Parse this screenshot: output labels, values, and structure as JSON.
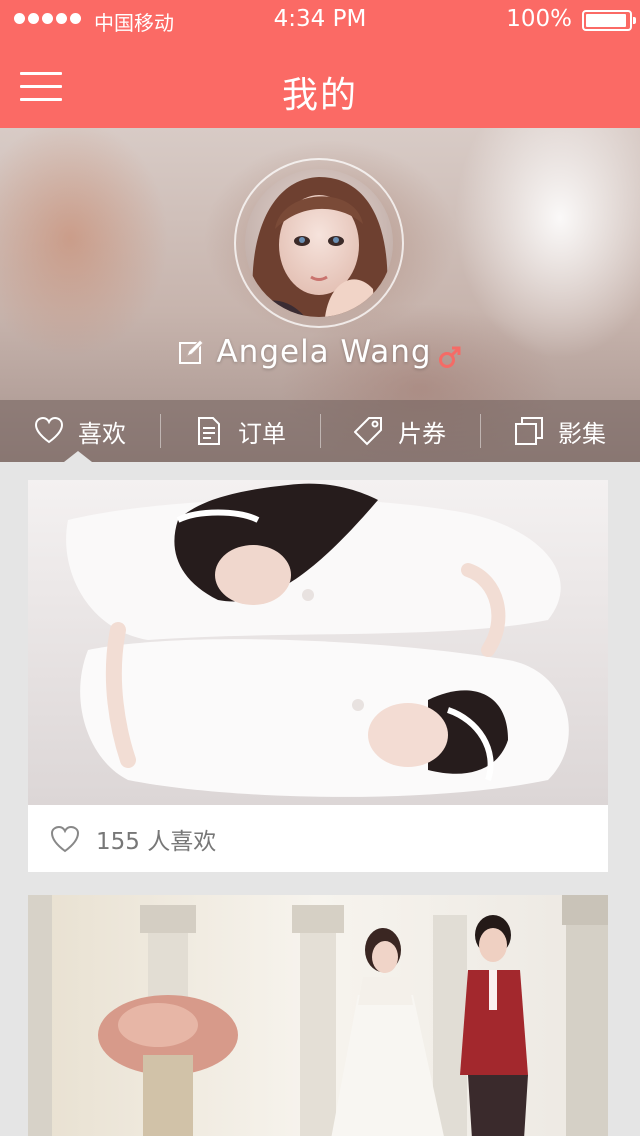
{
  "status_bar": {
    "carrier": "中国移动",
    "time": "4:34 PM",
    "battery": "100%"
  },
  "header": {
    "title": "我的",
    "menu_icon": "hamburger-menu-icon"
  },
  "profile": {
    "username": "Angela Wang",
    "edit_icon": "edit-icon",
    "gender_icon": "male-symbol-icon",
    "gender_color": "#f56b66"
  },
  "tabs": [
    {
      "label": "喜欢",
      "icon": "heart-icon",
      "active": true
    },
    {
      "label": "订单",
      "icon": "document-icon",
      "active": false
    },
    {
      "label": "片券",
      "icon": "tag-icon",
      "active": false
    },
    {
      "label": "影集",
      "icon": "album-icon",
      "active": false
    }
  ],
  "feed": [
    {
      "likes_text": "155 人喜欢",
      "like_icon": "heart-outline-icon"
    }
  ],
  "colors": {
    "accent": "#fb6a65",
    "background": "#e5e5e5"
  }
}
